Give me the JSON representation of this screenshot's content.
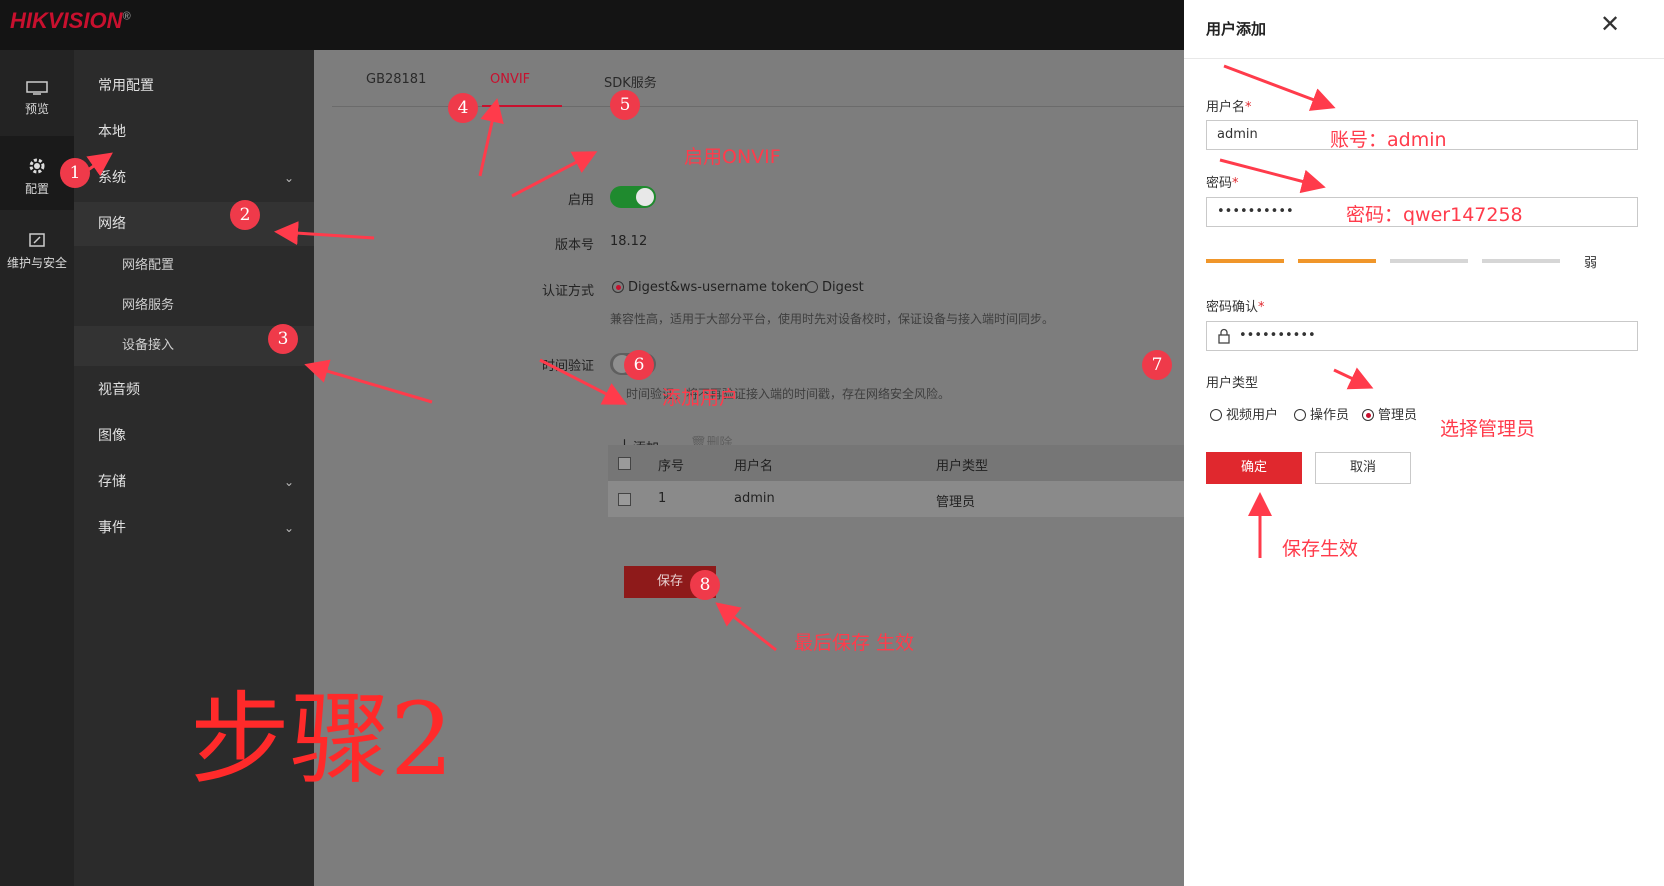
{
  "brand": {
    "logo": "HIKVISION",
    "trademark": "®"
  },
  "rail": [
    {
      "label": "预览",
      "icon": "monitor-icon"
    },
    {
      "label": "配置",
      "icon": "gear-icon"
    },
    {
      "label": "维护与安全",
      "icon": "maintenance-icon"
    }
  ],
  "menu": {
    "common": "常用配置",
    "local": "本地",
    "system": "系统",
    "network": "网络",
    "net_config": "网络配置",
    "net_service": "网络服务",
    "device_access": "设备接入",
    "av": "视音频",
    "image": "图像",
    "storage": "存储",
    "event": "事件"
  },
  "tabs": [
    "GB28181",
    "ONVIF",
    "SDK服务"
  ],
  "form": {
    "enable_label": "启用",
    "version_label": "版本号",
    "version_value": "18.12",
    "auth_label": "认证方式",
    "auth_opt1": "Digest&ws-username token",
    "auth_opt2": "Digest",
    "auth_hint": "兼容性高，适用于大部分平台，使用时先对设备校时，保证设备与接入端时间同步。",
    "time_label": "时间验证",
    "time_hint": "时间验证，将不再验证接入端的时间戳，存在网络安全风险。",
    "add_label": "添加",
    "delete_label": "删除",
    "save_label": "保存"
  },
  "table": {
    "headers": [
      "序号",
      "用户名",
      "用户类型"
    ],
    "rows": [
      {
        "index": "1",
        "username": "admin",
        "type": "管理员"
      }
    ]
  },
  "panel": {
    "title": "用户添加",
    "username_label": "用户名",
    "username_value": "admin",
    "password_label": "密码",
    "password_value": "••••••••••",
    "strength_text": "弱",
    "confirm_label": "密码确认",
    "confirm_value": "••••••••••",
    "type_label": "用户类型",
    "type_opts": [
      "视频用户",
      "操作员",
      "管理员"
    ],
    "ok_label": "确定",
    "cancel_label": "取消",
    "required_mark": "*"
  },
  "annotations": {
    "badges": [
      "1",
      "2",
      "3",
      "4",
      "5",
      "6",
      "7",
      "8"
    ],
    "enable_onvif": "启用ONVIF",
    "add_user": "添加用户",
    "account": "账号：admin",
    "password": "密码：qwer147258",
    "choose_admin": "选择管理员",
    "save_effect": "保存生效",
    "final_save": "最后保存 生效",
    "step": "步骤2"
  },
  "colors": {
    "brand_red": "#c8102e",
    "toggle_on": "#1f8a2e",
    "strength_on": "#f0962a",
    "strength_off": "#d6d6d6",
    "annotation_red": "#ff3b4b"
  }
}
